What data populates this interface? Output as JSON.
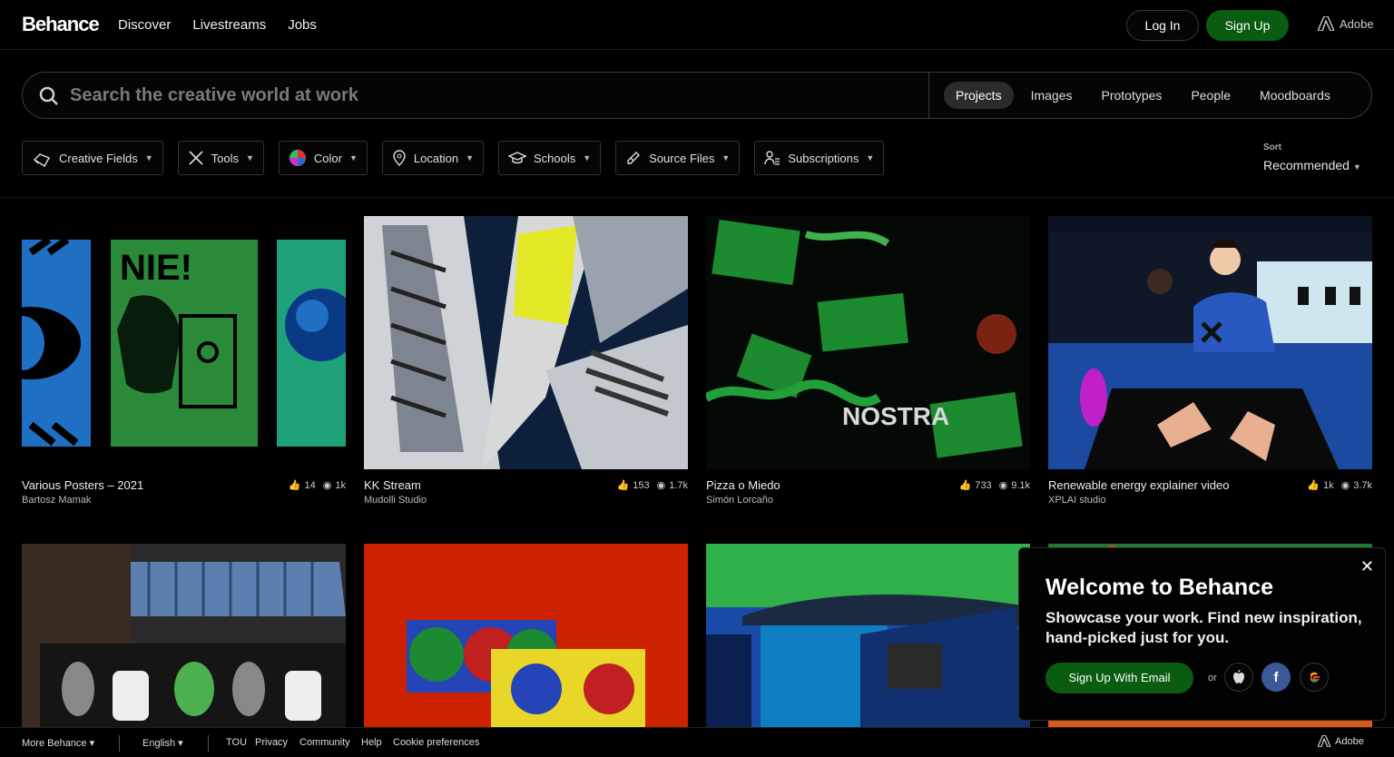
{
  "topnav": {
    "logo": "Behance",
    "links": [
      "Discover",
      "Livestreams",
      "Jobs"
    ],
    "login_label": "Log In",
    "signup_label": "Sign Up",
    "adobe_label": "Adobe"
  },
  "search": {
    "placeholder": "Search the creative world at work",
    "tabs": [
      "Projects",
      "Images",
      "Prototypes",
      "People",
      "Moodboards"
    ],
    "active_tab": "Projects"
  },
  "filters": {
    "items": [
      "Creative Fields",
      "Tools",
      "Color",
      "Location",
      "Schools",
      "Source Files",
      "Subscriptions"
    ],
    "sort_label": "Sort",
    "sort_value": "Recommended"
  },
  "projects": [
    {
      "title": "Various Posters – 2021",
      "owner": "Bartosz Mamak",
      "likes": "14",
      "views": "1k"
    },
    {
      "title": "KK Stream",
      "owner": "Mudolli Studio",
      "likes": "153",
      "views": "1.7k"
    },
    {
      "title": "Pizza o Miedo",
      "owner": "Simón Lorcaño",
      "likes": "733",
      "views": "9.1k"
    },
    {
      "title": "Renewable energy explainer video",
      "owner": "XPLAI studio",
      "likes": "1k",
      "views": "3.7k"
    }
  ],
  "welcome": {
    "title": "Welcome to Behance",
    "text": "Showcase your work. Find new inspiration, hand-picked just for you.",
    "signup_label": "Sign Up With Email",
    "or_label": "or"
  },
  "footer": {
    "more": "More Behance",
    "language": "English",
    "links": [
      "TOU",
      "Privacy",
      "Community",
      "Help",
      "Cookie preferences"
    ],
    "adobe_label": "Adobe"
  },
  "colors": {
    "accent_green": "#0a5c10",
    "facebook_blue": "#3b5998"
  }
}
